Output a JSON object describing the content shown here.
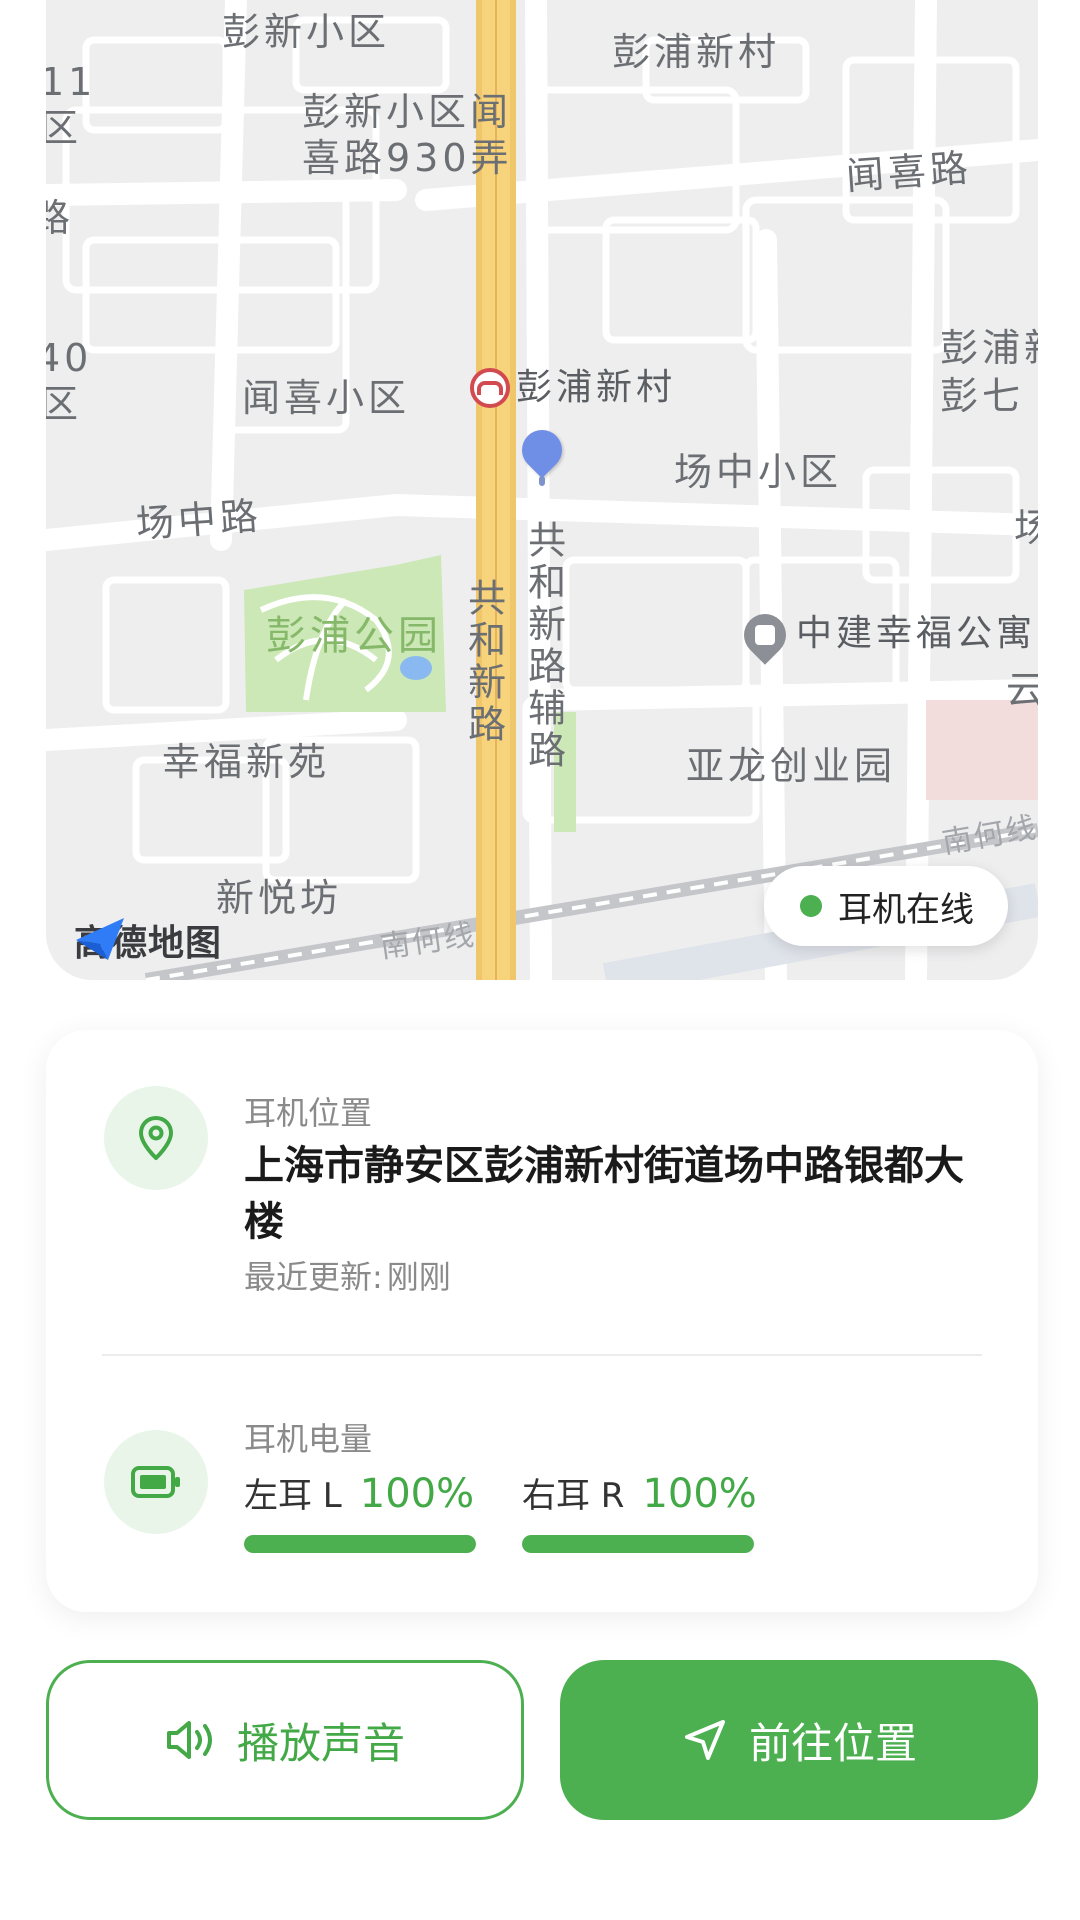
{
  "map": {
    "labels": {
      "pengxin_xiaoqu": "彭新小区",
      "pengpu_xincun_top": "彭浦新村",
      "pengxin_wenxi_1": "彭新小区闻",
      "pengxin_wenxi_2": "喜路930弄",
      "wenxi_road": "闻喜路",
      "wenxi_xiaoqu": "闻喜小区",
      "metro_station": "彭浦新村",
      "changzhong_xiaoqu": "场中小区",
      "changzhong_road": "场中路",
      "pengpu_park": "彭浦公园",
      "gonghexin_road": "共和新路",
      "gonghexin_aux": "共和新路辅路",
      "zhongjian": "中建幸福公寓",
      "xingfu_xinyuan": "幸福新苑",
      "yalong": "亚龙创业园",
      "xinyuefang": "新悦坊",
      "nanhe_line_1": "南何线",
      "nanhe_line_2": "南何线",
      "edge_11": "11",
      "edge_qu_1": "区",
      "edge_lu": "路",
      "edge_40": "40",
      "edge_qu_2": "区",
      "edge_pengpu_r": "彭浦新",
      "edge_pengqi": "彭七",
      "edge_chang": "场",
      "edge_yun": "云"
    },
    "logo_text": "高德地图",
    "status_text": "耳机在线",
    "status_color": "#4caf50"
  },
  "location": {
    "label": "耳机位置",
    "address": "上海市静安区彭浦新村街道场中路银都大楼",
    "updated_label": "最近更新:",
    "updated_value": "刚刚",
    "icon": "map-pin-icon"
  },
  "battery": {
    "label": "耳机电量",
    "icon": "battery-icon",
    "left": {
      "side": "左耳 L",
      "value": "100%",
      "level": 100
    },
    "right": {
      "side": "右耳 R",
      "value": "100%",
      "level": 100
    }
  },
  "actions": {
    "play_sound": {
      "label": "播放声音",
      "icon": "speaker-icon"
    },
    "navigate": {
      "label": "前往位置",
      "icon": "navigation-arrow-icon"
    }
  },
  "colors": {
    "accent": "#4caf50",
    "accent_text": "#43a947",
    "icon_bg": "#eaf5ea"
  }
}
